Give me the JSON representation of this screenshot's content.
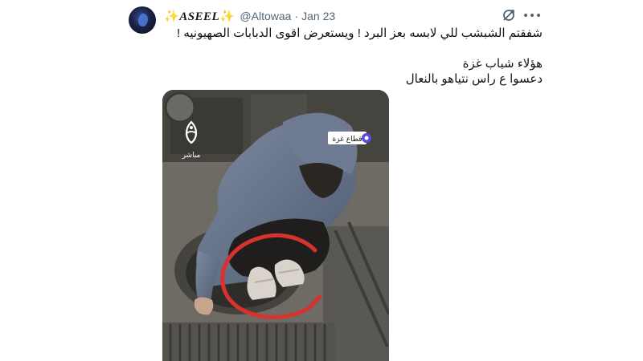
{
  "tweet": {
    "author": {
      "sparkle_left": "✨",
      "display_name": "ASEEL",
      "sparkle_right": "✨",
      "handle": "@Altowaa",
      "separator": "·",
      "date": "Jan 23"
    },
    "text_lines": [
      "شفقتم الشبشب للي لابسه بعز البرد ! ويستعرض اقوى الدبابات الصهيونيه !",
      "",
      "هؤلاء شباب غزة",
      "دعسوا ع راس نتياهو بالنعال"
    ],
    "media": {
      "watermark_text": "مباشر",
      "badge_text": "قطاع غزة"
    }
  },
  "icons": {
    "grok": "grok-icon",
    "more": "more-dots-icon"
  },
  "colors": {
    "text_primary": "#0f1419",
    "text_secondary": "#536471",
    "sparkle": "#f5b400",
    "annotation_circle": "#d6322e"
  }
}
